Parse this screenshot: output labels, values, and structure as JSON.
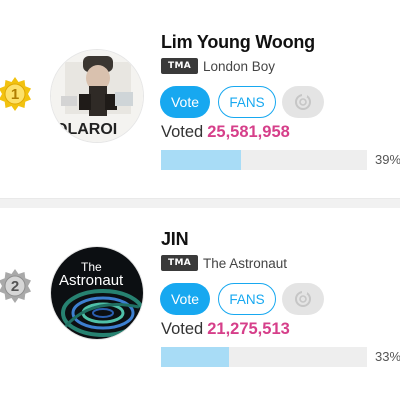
{
  "entries": [
    {
      "rank": "1",
      "name": "Lim Young Woong",
      "badge": "TMA",
      "song": "London Boy",
      "vote_label": "Vote",
      "fans_label": "FANS",
      "voted_label": "Voted",
      "votes": "25,581,958",
      "percent_label": "39%",
      "percent": 0.39,
      "album_art_text": "OLAROI",
      "medal_icon": "gold-medal-icon",
      "colors": {
        "medal": "#f2c20f"
      }
    },
    {
      "rank": "2",
      "name": "JIN",
      "badge": "TMA",
      "song": "The Astronaut",
      "vote_label": "Vote",
      "fans_label": "FANS",
      "voted_label": "Voted",
      "votes": "21,275,513",
      "percent_label": "33%",
      "percent": 0.33,
      "album_art_text_1": "The",
      "album_art_text_2": "Astronaut",
      "medal_icon": "silver-medal-icon",
      "colors": {
        "medal": "#a9a9a9"
      }
    }
  ],
  "colors": {
    "accent": "#17a8f0",
    "votes": "#d63f8a",
    "progress_fill": "#a8dcf6",
    "progress_track": "#eeeeee"
  }
}
